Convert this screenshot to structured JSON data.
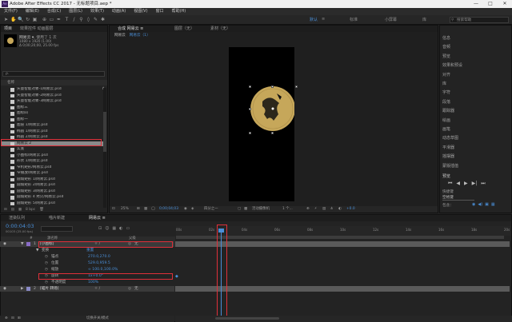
{
  "app": {
    "logo_text": "Ae",
    "title": "Adobe After Effects CC 2017 - 无标题项目.aep *",
    "window_controls": [
      "—",
      "□",
      "✕"
    ]
  },
  "menu": [
    "文件(F)",
    "编辑(E)",
    "合成(C)",
    "图层(L)",
    "效果(T)",
    "动画(A)",
    "视图(V)",
    "窗口",
    "帮助(H)"
  ],
  "toolbar": {
    "workspaces": [
      "默认",
      "≡",
      "标准",
      "小屏幕",
      "库"
    ],
    "search_placeholder": "搜索帮助"
  },
  "project_panel": {
    "tabs": [
      "项目",
      "效果控件 动画图层"
    ],
    "comp_name": "网易云 ▾",
    "comp_uses": ", 使用了 1 次",
    "comp_info1": "1080 x 1920 (1.00)",
    "comp_info2": "Δ 0;00;20;00, 25.00 fps",
    "search_placeholder": "ρ.",
    "column_label": "名称",
    "files": [
      "矢量智能对象-1网易云.psd",
      "矢量智能对象-2网易云.psd",
      "矢量智能对象-3网易云.psd",
      "图标三",
      "图标四",
      "图标一",
      "图层 1/网易云.psd",
      "椭圆 1/网易云.psd",
      "椭圆 2/网易云.psd",
      "网易云 2",
      "实底",
      "小图标/网易云.psd",
      "形状 1/网易云.psd",
      "窄机矩形/网易云.psd",
      "窄播放/网易云.psd",
      "圆角矩形 1/网易云.psd",
      "圆角矩形 2/网易云.psd",
      "圆角矩形 3/网易云.psd",
      "圆角矩形 4 拷贝/网易云.psd",
      "圆角矩形 5/网易云.psd"
    ],
    "selected_file_index": 9,
    "footer": "8 bpc"
  },
  "comp_viewer": {
    "tabs": [
      "合成 网易云 ≡",
      "图层（无）",
      "素材（无）"
    ],
    "breadcrumb": [
      "网易云",
      "网易云（1）"
    ],
    "zoom": "25%",
    "timecode": "0;00;04;03",
    "resolution": "四分之一",
    "camera": "活动摄像机",
    "views": "1 个...",
    "exposure": "+0.0"
  },
  "right_panel": {
    "items": [
      "信息",
      "音频",
      "预览",
      "效果和预设",
      "对齐",
      "库",
      "字符",
      "段落",
      "跟踪器",
      "绘画",
      "画笔",
      "动态草图",
      "平滑器",
      "摇摆器",
      "蒙版插值"
    ],
    "preview_label": "预览",
    "shortcut_label": "快捷键",
    "shortcut_value": "空格键",
    "include_label": "包含："
  },
  "timeline": {
    "tabs": [
      "渲染队列",
      "喵片新建",
      "网易云 ≡"
    ],
    "timecode": "0:00:04:03",
    "frame_info": "00103 (25.00 fps)",
    "column_headers": [
      "#",
      "源名称",
      "父级"
    ],
    "layers": [
      {
        "num": "1",
        "name": "[小图标]",
        "parent": "无"
      },
      {
        "num": "2",
        "name": "[喵片 转场]",
        "parent": "无"
      }
    ],
    "transform_label": "变换",
    "reset_label": "重置",
    "properties": [
      {
        "name": "锚点",
        "value": "270.0,270.0"
      },
      {
        "name": "位置",
        "value": "529.0,959.5"
      },
      {
        "name": "缩放",
        "value": "∞ 100.0,100.0%"
      },
      {
        "name": "旋转",
        "value": "1x+0.0°"
      },
      {
        "name": "不透明度",
        "value": "100%"
      }
    ],
    "ruler": [
      "00s",
      "02s",
      "04s",
      "06s",
      "08s",
      "10s",
      "12s",
      "14s",
      "16s",
      "18s",
      "20s"
    ],
    "footer": "切换开关/模式"
  }
}
